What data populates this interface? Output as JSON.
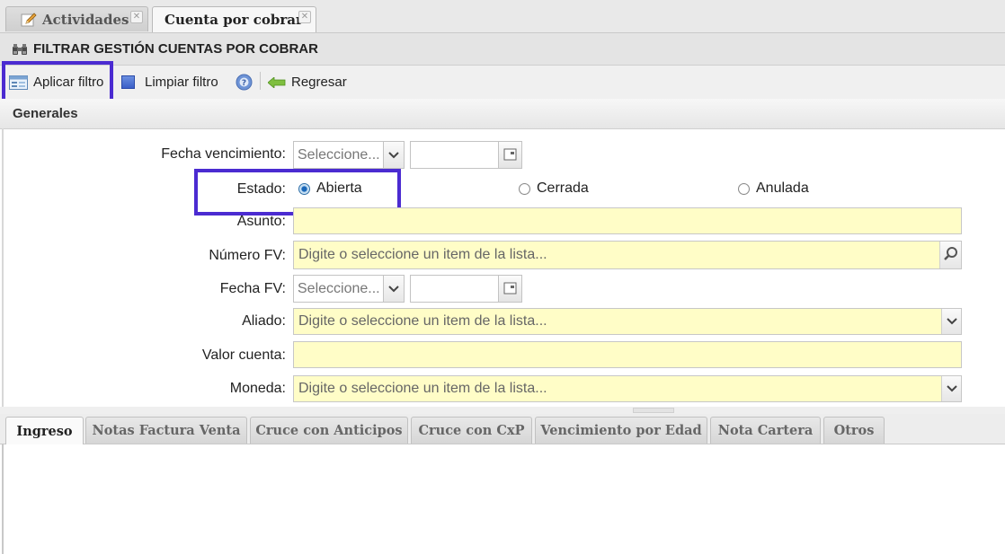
{
  "tabs": [
    {
      "label": "Actividades",
      "icon": "pencil-icon",
      "active": false
    },
    {
      "label": "Cuenta por cobrar",
      "active": true
    }
  ],
  "title": {
    "text": "FILTRAR GESTIÓN CUENTAS POR COBRAR",
    "icon": "binoculars-icon"
  },
  "toolbar": {
    "apply_label": "Aplicar filtro",
    "clear_label": "Limpiar filtro",
    "help_icon": "help-icon",
    "back_label": "Regresar"
  },
  "section": {
    "label": "Generales"
  },
  "form": {
    "fecha_vencimiento": {
      "label": "Fecha vencimiento:",
      "select_value": "Seleccione...",
      "date_value": ""
    },
    "estado": {
      "label": "Estado:",
      "options": [
        {
          "label": "Abierta",
          "selected": true
        },
        {
          "label": "Cerrada",
          "selected": false
        },
        {
          "label": "Anulada",
          "selected": false
        }
      ]
    },
    "asunto": {
      "label": "Asunto:",
      "value": ""
    },
    "numero_fv": {
      "label": "Número FV:",
      "placeholder": "Digite o seleccione un item de la lista..."
    },
    "fecha_fv": {
      "label": "Fecha FV:",
      "select_value": "Seleccione...",
      "date_value": ""
    },
    "aliado": {
      "label": "Aliado:",
      "placeholder": "Digite o seleccione un item de la lista..."
    },
    "valor_cuenta": {
      "label": "Valor cuenta:",
      "value": ""
    },
    "moneda": {
      "label": "Moneda:",
      "placeholder": "Digite o seleccione un item de la lista..."
    }
  },
  "bottom_tabs": [
    {
      "label": "Ingreso",
      "active": true
    },
    {
      "label": "Notas Factura Venta",
      "active": false
    },
    {
      "label": "Cruce con Anticipos",
      "active": false
    },
    {
      "label": "Cruce con CxP",
      "active": false
    },
    {
      "label": "Vencimiento por Edad",
      "active": false
    },
    {
      "label": "Nota Cartera",
      "active": false
    },
    {
      "label": "Otros",
      "active": false
    }
  ],
  "colors": {
    "highlight": "#4b2bd1",
    "input_bg": "#fffdc7",
    "radio_selected": "#1a67b8"
  }
}
